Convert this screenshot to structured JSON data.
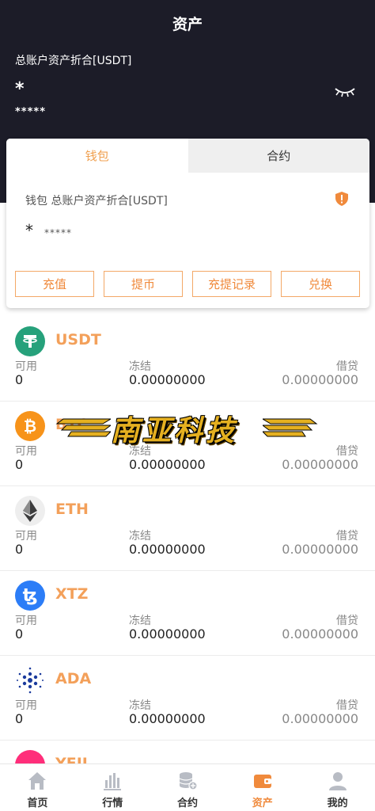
{
  "header": {
    "title": "资产",
    "total_label": "总账户资产折合[USDT]",
    "total_value": "*",
    "total_sub": "*****"
  },
  "card": {
    "tabs": [
      {
        "label": "钱包",
        "active": true
      },
      {
        "label": "合约",
        "active": false
      }
    ],
    "wallet_label": "钱包 总账户资产折合[USDT]",
    "wallet_value": "*",
    "wallet_sub": "*****",
    "actions": [
      "充值",
      "提币",
      "充提记录",
      "兑换"
    ]
  },
  "column_labels": {
    "available": "可用",
    "frozen": "冻结",
    "loan": "借贷"
  },
  "coins": [
    {
      "symbol": "USDT",
      "icon": "tether-icon",
      "color": "#26a17b",
      "available": "0",
      "frozen": "0.00000000",
      "loan": "0.00000000"
    },
    {
      "symbol": "BTC",
      "icon": "bitcoin-icon",
      "color": "#f7931a",
      "available": "0",
      "frozen": "0.00000000",
      "loan": "0.00000000"
    },
    {
      "symbol": "ETH",
      "icon": "ethereum-icon",
      "color": "#eeeeee",
      "available": "0",
      "frozen": "0.00000000",
      "loan": "0.00000000"
    },
    {
      "symbol": "XTZ",
      "icon": "tezos-icon",
      "color": "#2c7df7",
      "available": "0",
      "frozen": "0.00000000",
      "loan": "0.00000000"
    },
    {
      "symbol": "ADA",
      "icon": "cardano-icon",
      "color": "#ffffff",
      "available": "0",
      "frozen": "0.00000000",
      "loan": "0.00000000"
    },
    {
      "symbol": "YFII",
      "icon": "yfii-icon",
      "color": "#ff2e7a",
      "available": "",
      "frozen": "",
      "loan": ""
    }
  ],
  "watermark": {
    "text": "南亚科技"
  },
  "tabbar": [
    {
      "label": "首页",
      "icon": "home-icon",
      "active": false
    },
    {
      "label": "行情",
      "icon": "chart-icon",
      "active": false
    },
    {
      "label": "合约",
      "icon": "database-icon",
      "active": false
    },
    {
      "label": "资产",
      "icon": "wallet-icon",
      "active": true
    },
    {
      "label": "我的",
      "icon": "user-icon",
      "active": false
    }
  ],
  "colors": {
    "accent": "#f08a3c",
    "header_bg": "#1c1c28"
  }
}
